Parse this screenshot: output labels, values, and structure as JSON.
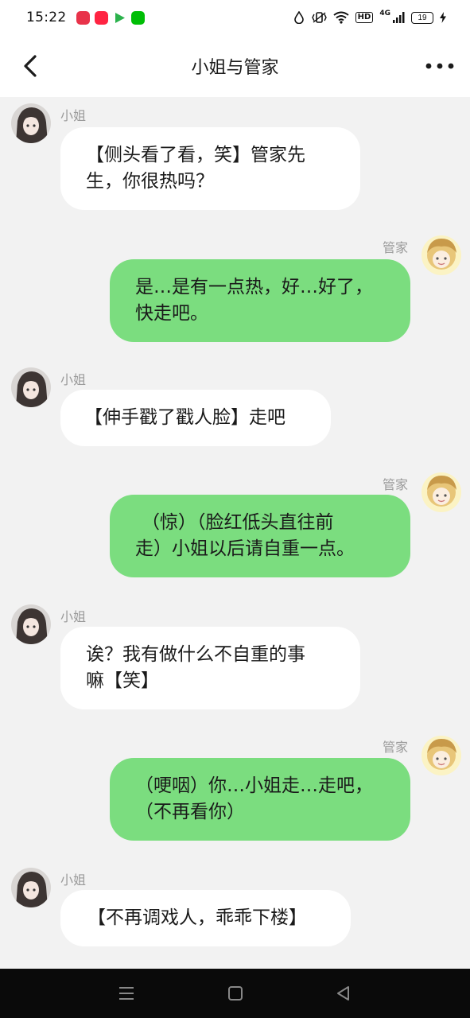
{
  "status_bar": {
    "time": "15:22",
    "battery": "19",
    "network": "4G",
    "hd": "HD",
    "app_icons": [
      "pinduoduo-icon",
      "xiaohongshu-icon",
      "play-icon",
      "iqiyi-icon"
    ]
  },
  "header": {
    "title": "小姐与管家"
  },
  "colors": {
    "bubble_left": "#ffffff",
    "bubble_right": "#7bdd7f",
    "background": "#f2f2f2"
  },
  "messages": [
    {
      "sender": "小姐",
      "side": "left",
      "lines": [
        "【侧头看了看，笑】管家先",
        "生，你很热吗？"
      ]
    },
    {
      "sender": "管家",
      "side": "right",
      "lines": [
        "是…是有一点热，好…好了，",
        "快走吧。"
      ]
    },
    {
      "sender": "小姐",
      "side": "left",
      "lines": [
        "【伸手戳了戳人脸】走吧"
      ]
    },
    {
      "sender": "管家",
      "side": "right",
      "lines": [
        "（惊）（脸红低头直往前",
        "走）小姐以后请自重一点。"
      ]
    },
    {
      "sender": "小姐",
      "side": "left",
      "lines": [
        "诶？我有做什么不自重的事",
        "嘛【笑】"
      ]
    },
    {
      "sender": "管家",
      "side": "right",
      "lines": [
        "（哽咽）你…小姐走…走吧，",
        "（不再看你）"
      ]
    },
    {
      "sender": "小姐",
      "side": "left",
      "lines": [
        "【不再调戏人，乖乖下楼】"
      ]
    }
  ]
}
